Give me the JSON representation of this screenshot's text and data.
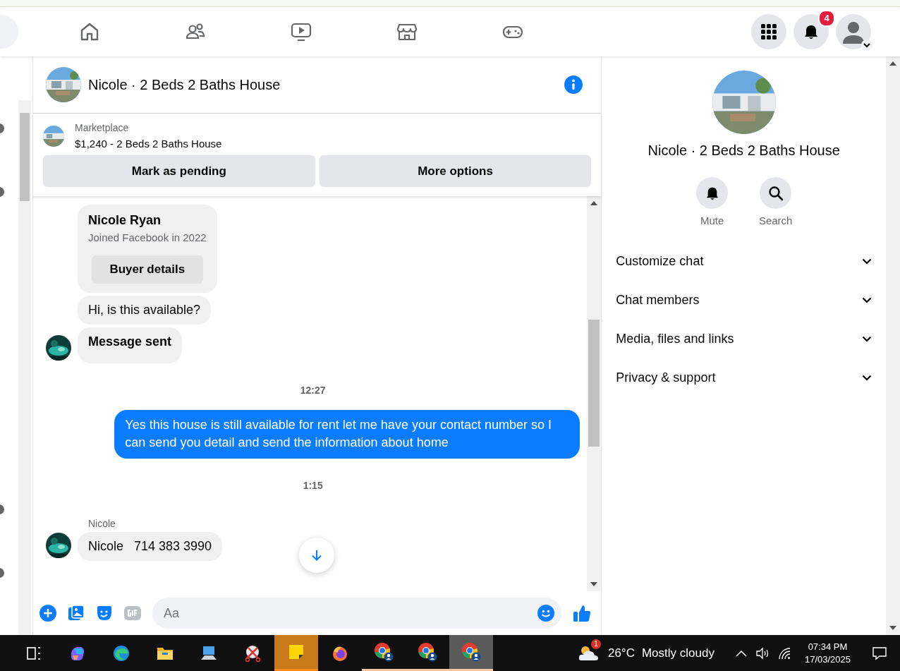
{
  "nav": {
    "tabs": [
      {
        "kind": "home"
      },
      {
        "kind": "friends"
      },
      {
        "kind": "video"
      },
      {
        "kind": "marketplace"
      },
      {
        "kind": "gaming"
      }
    ],
    "notification_count": "4"
  },
  "chat": {
    "title": "Nicole · 2 Beds 2 Baths House",
    "listing": {
      "source": "Marketplace",
      "summary": "$1,240 - 2 Beds 2 Baths House",
      "buttons": [
        "Mark as pending",
        "More options"
      ]
    },
    "messages": [
      {
        "kind": "profile",
        "name": "Nicole Ryan",
        "subtitle": "Joined Facebook in 2022",
        "button": "Buyer details"
      },
      {
        "kind": "incoming",
        "text": "Hi, is this available?",
        "avatar": false
      },
      {
        "kind": "incoming-bold",
        "text": "Message sent",
        "avatar": true
      },
      {
        "kind": "time",
        "text": "12:27"
      },
      {
        "kind": "outgoing",
        "text": "Yes this house is still available for rent let me have your contact number so I can send you detail and send the information about home"
      },
      {
        "kind": "time",
        "text": "1:15"
      },
      {
        "kind": "sender",
        "text": "Nicole"
      },
      {
        "kind": "incoming",
        "text": "Nicole   714 383 3990",
        "avatar": true
      }
    ],
    "composer": {
      "placeholder": "Aa"
    }
  },
  "details": {
    "name": "Nicole · 2 Beds 2 Baths House",
    "actions": [
      {
        "kind": "mute",
        "label": "Mute"
      },
      {
        "kind": "search",
        "label": "Search"
      }
    ],
    "sections": [
      {
        "label": "Customize chat",
        "expanded": false
      },
      {
        "label": "Chat members",
        "expanded": false
      },
      {
        "label": "Media, files and links",
        "expanded": false
      },
      {
        "label": "Privacy & support",
        "expanded": false
      }
    ]
  },
  "taskbar": {
    "apps": [
      {
        "kind": "taskview",
        "running": false,
        "selected": false,
        "flashing": false
      },
      {
        "kind": "copilot",
        "running": false,
        "selected": false,
        "flashing": false
      },
      {
        "kind": "edge",
        "running": false,
        "selected": false,
        "flashing": false
      },
      {
        "kind": "files",
        "running": false,
        "selected": false,
        "flashing": false
      },
      {
        "kind": "pc",
        "running": false,
        "selected": false,
        "flashing": false
      },
      {
        "kind": "snip",
        "running": false,
        "selected": false,
        "flashing": false
      },
      {
        "kind": "notes",
        "running": true,
        "selected": false,
        "flashing": true
      },
      {
        "kind": "firefox",
        "running": false,
        "selected": false,
        "flashing": false
      },
      {
        "kind": "chrome",
        "running": true,
        "selected": false,
        "flashing": false
      },
      {
        "kind": "chrome",
        "running": true,
        "selected": false,
        "flashing": false
      },
      {
        "kind": "chrome",
        "running": true,
        "selected": true,
        "flashing": false
      }
    ],
    "weather": {
      "badge": "1",
      "temperature": "26°C",
      "condition": "Mostly cloudy"
    },
    "time": "07:34 PM",
    "date": "17/03/2025"
  }
}
